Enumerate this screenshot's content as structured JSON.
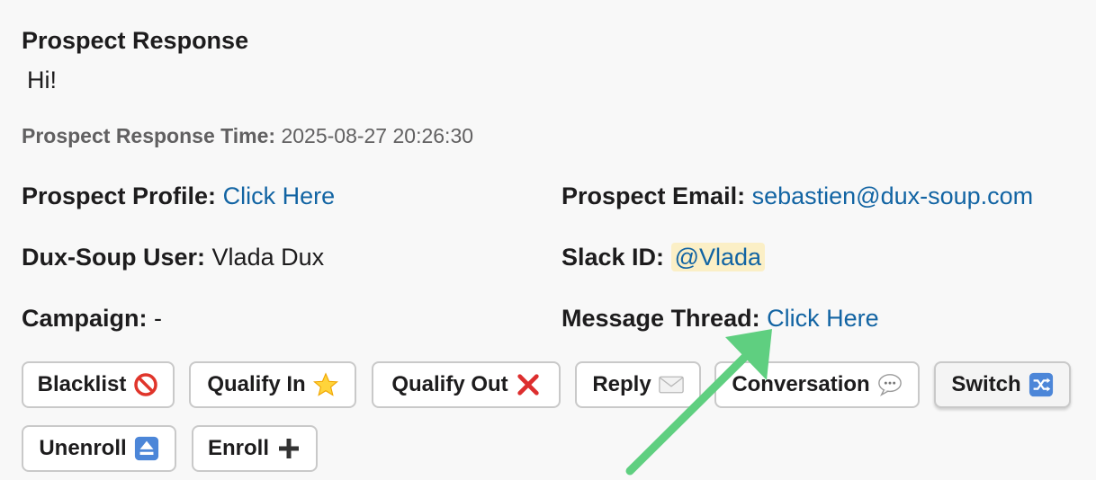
{
  "response": {
    "heading": "Prospect Response",
    "text": "Hi!",
    "time_label": "Prospect Response Time:",
    "time_value": "2025-08-27 20:26:30"
  },
  "fields": {
    "profile_label": "Prospect Profile:",
    "profile_link": "Click Here",
    "email_label": "Prospect Email:",
    "email_value": "sebastien@dux-soup.com",
    "user_label": "Dux-Soup User:",
    "user_value": "Vlada Dux",
    "slack_label": "Slack ID:",
    "slack_value": "@Vlada",
    "campaign_label": "Campaign:",
    "campaign_value": "-",
    "thread_label": "Message Thread:",
    "thread_link": "Click Here"
  },
  "buttons": {
    "blacklist": "Blacklist",
    "qualify_in": "Qualify In",
    "qualify_out": "Qualify Out",
    "reply": "Reply",
    "conversation": "Conversation",
    "switch": "Switch",
    "unenroll": "Unenroll",
    "enroll": "Enroll"
  },
  "icons": {
    "blacklist": "prohibited-icon",
    "qualify_in": "star-icon",
    "qualify_out": "cross-mark-icon",
    "reply": "envelope-icon",
    "conversation": "speech-bubble-icon",
    "switch": "shuffle-icon",
    "unenroll": "eject-icon",
    "enroll": "plus-icon"
  },
  "colors": {
    "link": "#1264a3",
    "mention_bg": "#fbefc6",
    "annotation_arrow": "#5fcf80"
  }
}
